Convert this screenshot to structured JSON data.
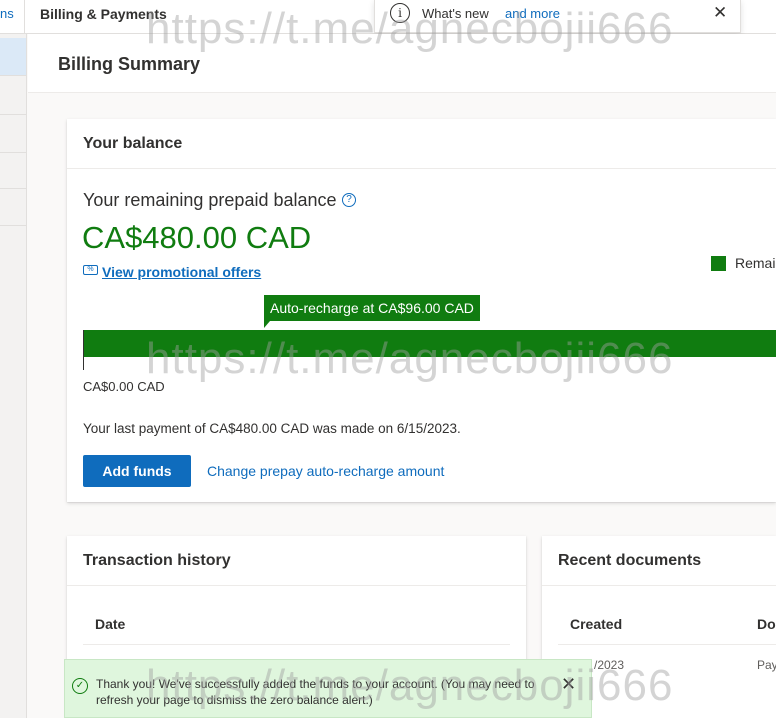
{
  "header": {
    "left_fragment": "ns",
    "section_title": "Billing & Payments"
  },
  "whats_new": {
    "icon": "info-icon",
    "text": "What's new",
    "link": "and more"
  },
  "page": {
    "title": "Billing Summary"
  },
  "balance_card": {
    "title": "Your balance",
    "remaining_label": "Your remaining prepaid balance",
    "amount": "CA$480.00 CAD",
    "promo_link": "View promotional offers",
    "legend_label": "Remain",
    "auto_recharge_tooltip": "Auto-recharge at CA$96.00 CAD",
    "bar_fill_fraction": 1.0,
    "bar_min_label": "CA$0.00 CAD",
    "last_payment": "Your last payment of CA$480.00 CAD was made on 6/15/2023.",
    "add_funds_button": "Add funds",
    "change_link": "Change prepay auto-recharge amount"
  },
  "transaction_history": {
    "title": "Transaction history",
    "columns": [
      "Date"
    ]
  },
  "recent_documents": {
    "title": "Recent documents",
    "columns": [
      "Created",
      "Do"
    ],
    "rows": [
      [
        "/2023",
        "Pay"
      ]
    ]
  },
  "toast": {
    "message": "Thank you! We've successfully added the funds to your account. (You may need to refresh your page to dismiss the zero balance alert.)"
  },
  "watermark": "https://t.me/agnecbojii666",
  "colors": {
    "accent": "#0f6cbd",
    "success": "#107c10",
    "toast_bg": "#dff6dd"
  }
}
